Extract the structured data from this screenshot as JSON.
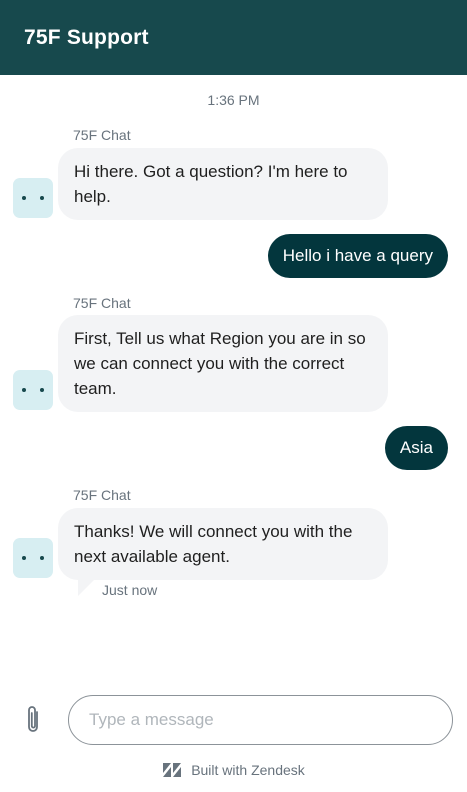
{
  "header": {
    "title": "75F Support"
  },
  "conversation": {
    "timestamp": "1:36 PM",
    "messages": [
      {
        "role": "bot",
        "sender": "75F Chat",
        "text": "Hi there. Got a question? I'm here to help."
      },
      {
        "role": "user",
        "text": "Hello i have a query"
      },
      {
        "role": "bot",
        "sender": "75F Chat",
        "text": "First, Tell us what Region you are in so we can connect you with the correct team."
      },
      {
        "role": "user",
        "text": "Asia"
      },
      {
        "role": "bot",
        "sender": "75F Chat",
        "text": "Thanks! We will connect you with the next available agent.",
        "status": "Just now"
      }
    ]
  },
  "composer": {
    "placeholder": "Type a message"
  },
  "footer": {
    "branding": "Built with Zendesk"
  },
  "colors": {
    "header": "#17494d",
    "user_bubble": "#03363d",
    "bot_bubble": "#f3f4f6",
    "avatar_bg": "#d7eef2"
  }
}
